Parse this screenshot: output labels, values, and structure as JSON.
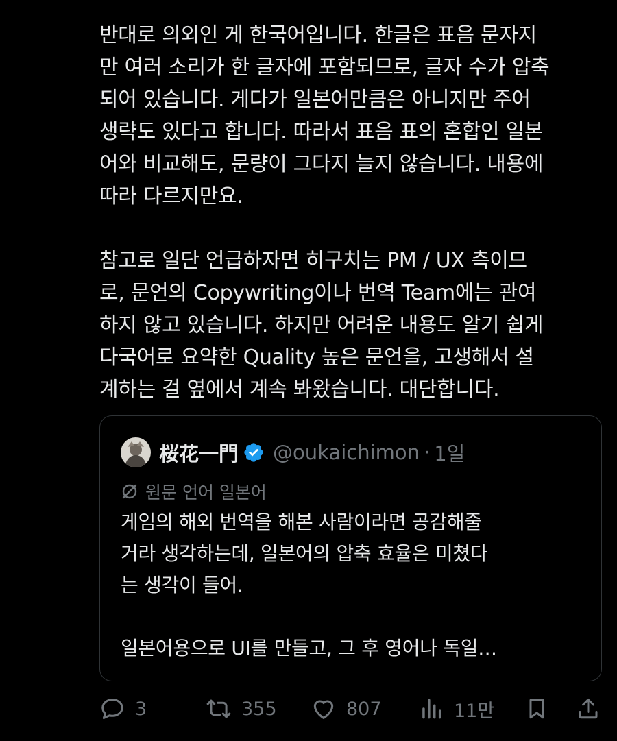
{
  "post": {
    "paragraphs": [
      [
        "반대로 의외인 게 한국어입니다. 한글은 표음 문자지",
        "만 여러 소리가 한 글자에 포함되므로, 글자 수가 압축",
        "되어 있습니다. 게다가 일본어만큼은 아니지만 주어",
        "생략도 있다고 합니다. 따라서 표음 표의 혼합인 일본",
        "어와 비교해도, 문량이 그다지 늘지 않습니다. 내용에",
        "따라 다르지만요."
      ],
      [
        "참고로 일단 언급하자면 히구치는 PM / UX 측이므",
        "로, 문언의 Copywriting이나 번역 Team에는 관여",
        "하지 않고 있습니다. 하지만 어려운 내용도 알기 쉽게",
        "다국어로 요약한 Quality 높은 문언을, 고생해서 설",
        "계하는 걸 옆에서 계속 봐왔습니다. 대단합니다."
      ]
    ]
  },
  "quote": {
    "author_name": "桜花一門",
    "handle": "@oukaichimon",
    "separator": "·",
    "time": "1일",
    "translate_label": "원문 언어 일본어",
    "paragraphs": [
      [
        "게임의 해외 번역을 해본 사람이라면 공감해줄",
        "거라 생각하는데, 일본어의 압축 효율은 미쳤다",
        "는 생각이 들어."
      ],
      [
        "일본어용으로 UI를 만들고, 그 후 영어나 독일…"
      ]
    ]
  },
  "actions": {
    "replies": "3",
    "reposts": "355",
    "likes": "807",
    "views": "11만"
  },
  "colors": {
    "background": "#000000",
    "text": "#e7e9ea",
    "muted": "#71767b",
    "border": "#2f3336",
    "verified": "#1d9bf0"
  }
}
